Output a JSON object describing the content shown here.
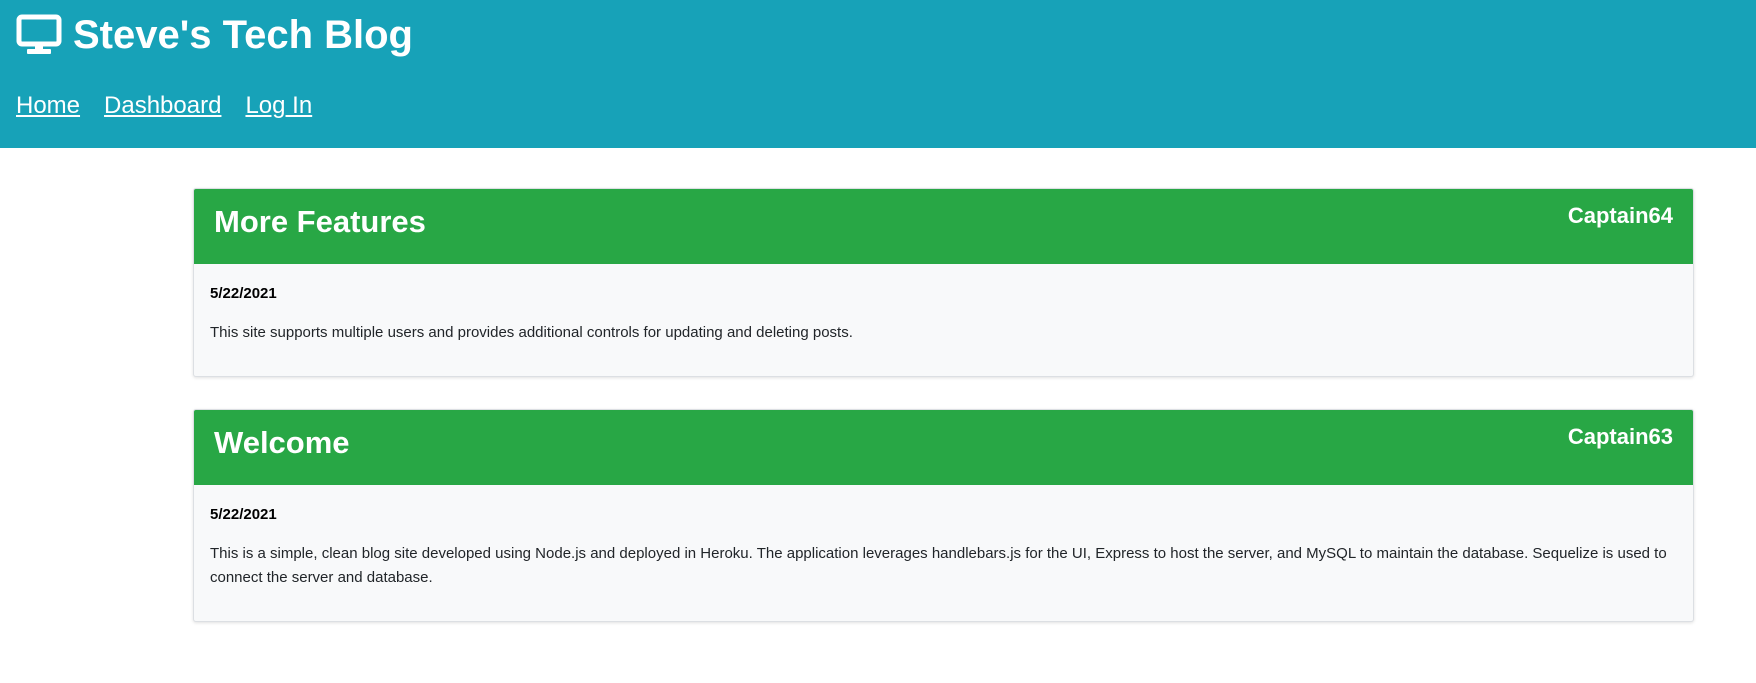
{
  "header": {
    "title": "Steve's Tech Blog",
    "icon": "desktop-monitor-icon",
    "background": "#17a2b8",
    "nav": [
      {
        "label": "Home"
      },
      {
        "label": "Dashboard"
      },
      {
        "label": "Log In"
      }
    ]
  },
  "posts": [
    {
      "title": "More Features",
      "author": "Captain64",
      "date": "5/22/2021",
      "content": "This site supports multiple users and provides additional controls for updating and deleting posts."
    },
    {
      "title": "Welcome",
      "author": "Captain63",
      "date": "5/22/2021",
      "content": "This is a simple, clean blog site developed using Node.js and deployed in Heroku. The application leverages handlebars.js for the UI, Express to host the server, and MySQL to maintain the database. Sequelize is used to connect the server and database."
    }
  ],
  "colors": {
    "post_header": "#28a745",
    "post_body": "#f8f9fa"
  }
}
